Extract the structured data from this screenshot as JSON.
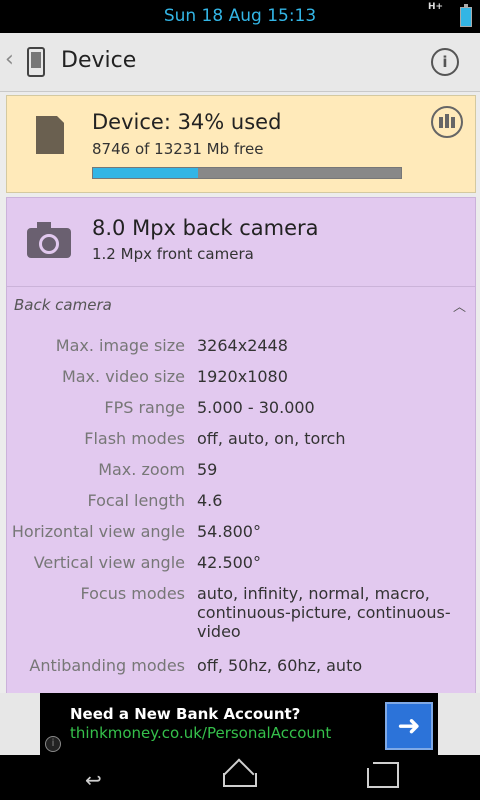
{
  "status_bar": {
    "time": "Sun 18 Aug 15:13",
    "network_icon": "hplus-signal-icon",
    "network_text": "H+",
    "battery_icon": "battery-icon"
  },
  "action_bar": {
    "back_icon": "chevron-left-icon",
    "app_icon": "phone-icon",
    "title": "Device",
    "info_icon": "info-icon"
  },
  "storage": {
    "icon": "sd-card-icon",
    "headline": "Device: 34% used",
    "subline": "8746 of 13231 Mb free",
    "used_fraction": 0.34,
    "chart_icon": "bar-chart-icon"
  },
  "camera": {
    "icon": "camera-icon",
    "headline": "8.0 Mpx back camera",
    "subline": "1.2 Mpx front camera",
    "section_title": "Back camera",
    "collapse_icon": "chevron-up-icon",
    "rows": [
      {
        "label": "Max. image size",
        "value": "3264x2448"
      },
      {
        "label": "Max. video size",
        "value": "1920x1080"
      },
      {
        "label": "FPS range",
        "value": "5.000 - 30.000"
      },
      {
        "label": "Flash modes",
        "value": "off, auto, on, torch"
      },
      {
        "label": "Max. zoom",
        "value": "59"
      },
      {
        "label": "Focal length",
        "value": "4.6"
      },
      {
        "label": "Horizontal view angle",
        "value": "54.800°"
      },
      {
        "label": "Vertical view angle",
        "value": "42.500°"
      },
      {
        "label": "Focus modes",
        "value": "auto, infinity, normal, macro, continuous-picture, continuous-video"
      },
      {
        "label": "Antibanding modes",
        "value": "off, 50hz, 60hz, auto"
      }
    ]
  },
  "ad": {
    "title": "Need a New Bank Account?",
    "link": "thinkmoney.co.uk/PersonalAccount",
    "arrow_icon": "arrow-right-icon",
    "info_icon": "info-icon"
  },
  "nav_bar": {
    "back_icon": "back-icon",
    "home_icon": "home-icon",
    "recents_icon": "recents-icon"
  },
  "colors": {
    "accent": "#33b5e5",
    "storage_card": "#ffeaba",
    "camera_card": "#e2c9ef",
    "ad_link": "#35c04b",
    "ad_button": "#2c73d9"
  }
}
